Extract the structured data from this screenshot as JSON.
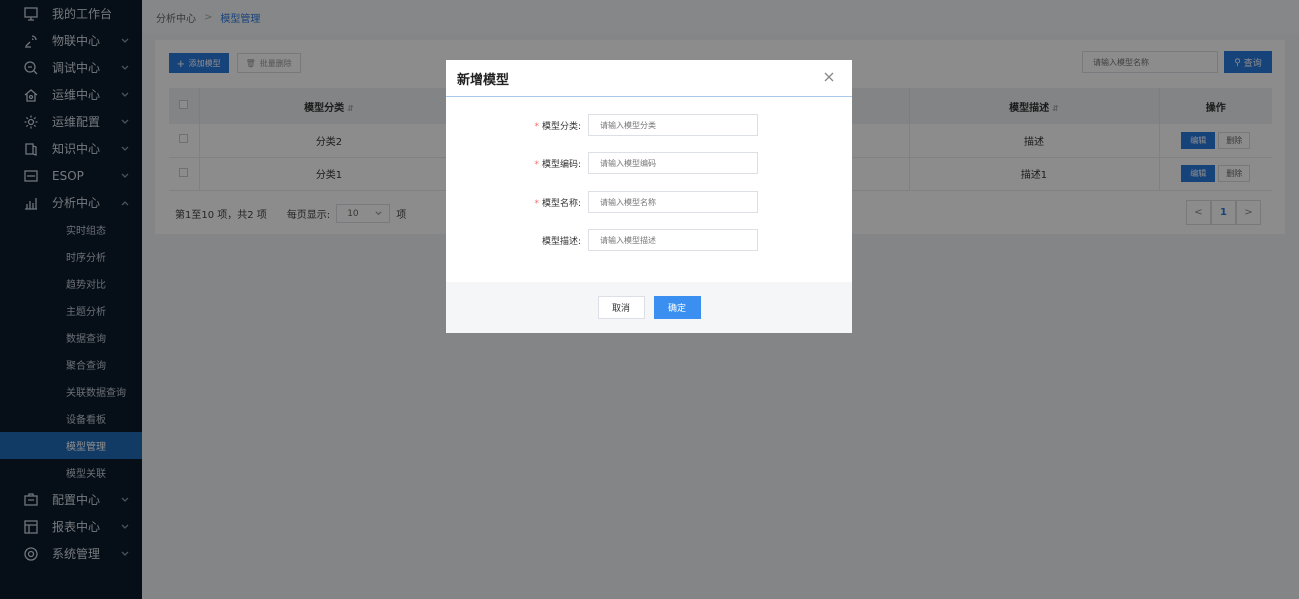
{
  "sidebar": {
    "items": [
      {
        "label": "我的工作台",
        "icon": "monitor-icon",
        "has_children": false
      },
      {
        "label": "物联中心",
        "icon": "satellite-icon",
        "has_children": true
      },
      {
        "label": "调试中心",
        "icon": "debug-icon",
        "has_children": true
      },
      {
        "label": "运维中心",
        "icon": "home-gear-icon",
        "has_children": true
      },
      {
        "label": "运维配置",
        "icon": "gear-icon",
        "has_children": true
      },
      {
        "label": "知识中心",
        "icon": "book-icon",
        "has_children": true
      },
      {
        "label": "ESOP",
        "icon": "esop-icon",
        "has_children": true
      },
      {
        "label": "分析中心",
        "icon": "chart-icon",
        "has_children": true,
        "expanded": true
      }
    ],
    "sub_items": [
      "实时组态",
      "时序分析",
      "趋势对比",
      "主题分析",
      "数据查询",
      "聚合查询",
      "关联数据查询",
      "设备看板",
      "模型管理",
      "模型关联"
    ],
    "active_sub": "模型管理",
    "bottom_items": [
      {
        "label": "配置中心",
        "icon": "config-icon"
      },
      {
        "label": "报表中心",
        "icon": "report-icon"
      },
      {
        "label": "系统管理",
        "icon": "settings-icon"
      }
    ]
  },
  "breadcrumb": {
    "parent": "分析中心",
    "current": "模型管理"
  },
  "toolbar": {
    "add_label": "添加模型",
    "batch_delete_label": "批量删除"
  },
  "search": {
    "placeholder": "请输入模型名称",
    "button_label": "查询"
  },
  "table": {
    "columns": [
      "模型分类",
      "模型描述",
      "操作"
    ],
    "rows": [
      {
        "category": "分类2",
        "description": "描述",
        "edit": "编辑",
        "delete": "删除"
      },
      {
        "category": "分类1",
        "description": "描述1",
        "edit": "编辑",
        "delete": "删除"
      }
    ]
  },
  "pagination": {
    "summary": "第1至10 项，共2 项",
    "per_page_label": "每页显示:",
    "per_page_value": "10",
    "unit": "项",
    "current_page": "1"
  },
  "dialog": {
    "title": "新增模型",
    "fields": [
      {
        "label": "模型分类:",
        "placeholder": "请输入模型分类",
        "required": true
      },
      {
        "label": "模型编码:",
        "placeholder": "请输入模型编码",
        "required": true
      },
      {
        "label": "模型名称:",
        "placeholder": "请输入模型名称",
        "required": true
      },
      {
        "label": "模型描述:",
        "placeholder": "请输入模型描述",
        "required": false
      }
    ],
    "cancel_label": "取消",
    "confirm_label": "确定"
  },
  "colors": {
    "sidebar_bg": "#0b1a2b",
    "accent": "#2b7be0",
    "required": "#f56c6c"
  }
}
